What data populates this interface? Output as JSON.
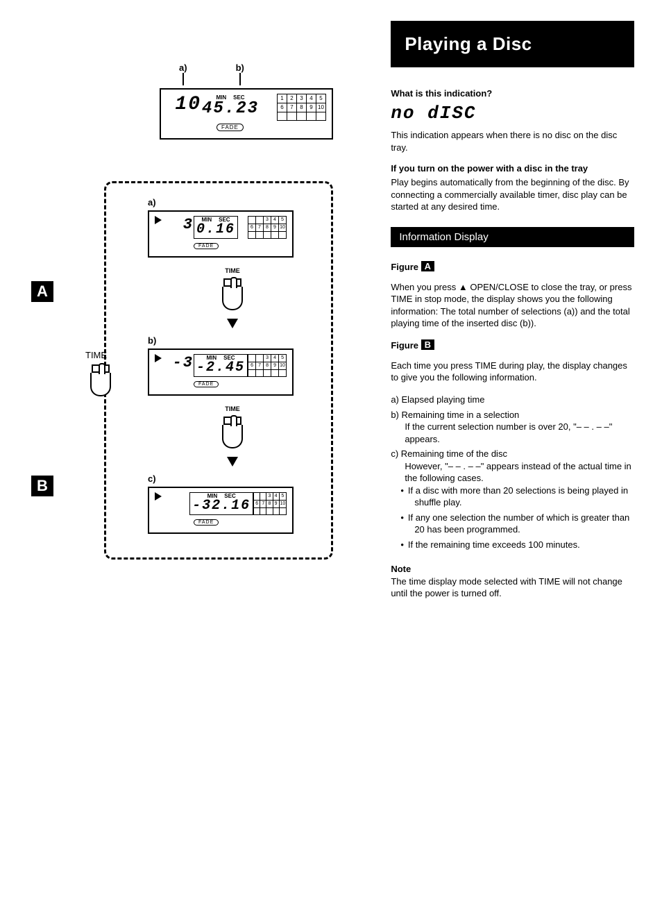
{
  "title": "Playing a Disc",
  "what_is": "What is this indication?",
  "no_disc_display": "no dISC",
  "no_disc_text": "This indication appears when there is no disc on the disc tray.",
  "power_on_head": "If you turn on the power with a disc in the tray",
  "power_on_text": "Play begins automatically from the beginning of the disc. By connecting a commercially available timer, disc play can be started at any desired time.",
  "info_header": "Information Display",
  "figA": {
    "head": "Figure",
    "letter": "A",
    "text": "When you press ▲ OPEN/CLOSE to close the tray, or press TIME in stop mode, the display shows you the following information: The total number of selections (a)) and the total playing time of the inserted disc (b)).",
    "ann_a": "a)",
    "ann_b": "b)",
    "lcd": {
      "track": "10",
      "min_lbl": "MIN",
      "sec_lbl": "SEC",
      "time": "45.23",
      "fade": "FADE",
      "grid": [
        "1",
        "2",
        "3",
        "4",
        "5",
        "6",
        "7",
        "8",
        "9",
        "10"
      ]
    }
  },
  "figB": {
    "head": "Figure",
    "letter": "B",
    "intro": "Each time you press TIME during play, the display changes to give you the following information.",
    "items": {
      "a": "Elapsed playing time",
      "b": "Remaining time in a selection",
      "b_sub": "If the current selection number is over 20, \"– – . – –\" appears.",
      "c": "Remaining time of the disc",
      "c_sub": "However, \"– – . – –\" appears instead of the actual time in the following cases.",
      "c_bullets": [
        "If a disc with more than 20 selections is being played in shuffle play.",
        "If any one selection the number of which is greater than 20 has been programmed.",
        "If the remaining time exceeds 100 minutes."
      ]
    },
    "time_btn": "TIME",
    "labels": {
      "a": "a)",
      "b": "b)",
      "c": "c)"
    },
    "lcd_a": {
      "track": "3",
      "time": "0.16",
      "boxed": true
    },
    "lcd_b": {
      "track": "-3",
      "time": "-2.45",
      "boxed": true
    },
    "lcd_c": {
      "track": "",
      "time": "-32.16",
      "boxed": true
    },
    "grid": [
      "",
      "",
      "3",
      "4",
      "5",
      "6",
      "7",
      "8",
      "9",
      "10"
    ],
    "min_lbl": "MIN",
    "sec_lbl": "SEC",
    "fade": "FADE"
  },
  "note_head": "Note",
  "note_text": "The time display mode selected with TIME will not change until the power is turned off."
}
